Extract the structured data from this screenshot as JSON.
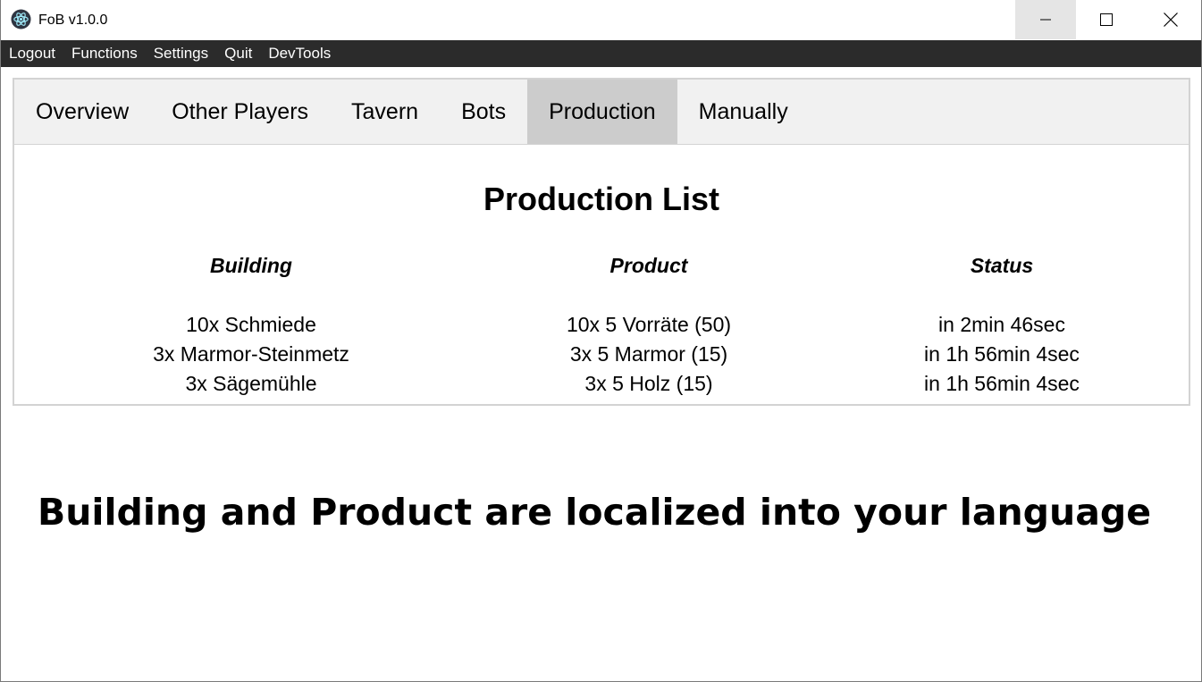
{
  "window": {
    "title": "FoB v1.0.0",
    "icon": "electron-atom-icon"
  },
  "menu": {
    "items": [
      "Logout",
      "Functions",
      "Settings",
      "Quit",
      "DevTools"
    ]
  },
  "tabs": {
    "items": [
      "Overview",
      "Other Players",
      "Tavern",
      "Bots",
      "Production",
      "Manually"
    ],
    "active": "Production"
  },
  "production": {
    "title": "Production List",
    "headers": {
      "building": "Building",
      "product": "Product",
      "status": "Status"
    },
    "rows": [
      {
        "building": "10x Schmiede",
        "product": "10x 5 Vorräte (50)",
        "status": "in 2min 46sec"
      },
      {
        "building": "3x Marmor-Steinmetz",
        "product": "3x 5 Marmor (15)",
        "status": "in 1h 56min 4sec"
      },
      {
        "building": "3x Sägemühle",
        "product": "3x 5 Holz (15)",
        "status": "in 1h 56min 4sec"
      }
    ]
  },
  "caption": "Building and Product are localized into your language",
  "colors": {
    "menubar_bg": "#2b2b2b",
    "tabbar_bg": "#f1f1f1",
    "active_tab_bg": "#cccccc",
    "panel_border": "#d3d3d3"
  }
}
